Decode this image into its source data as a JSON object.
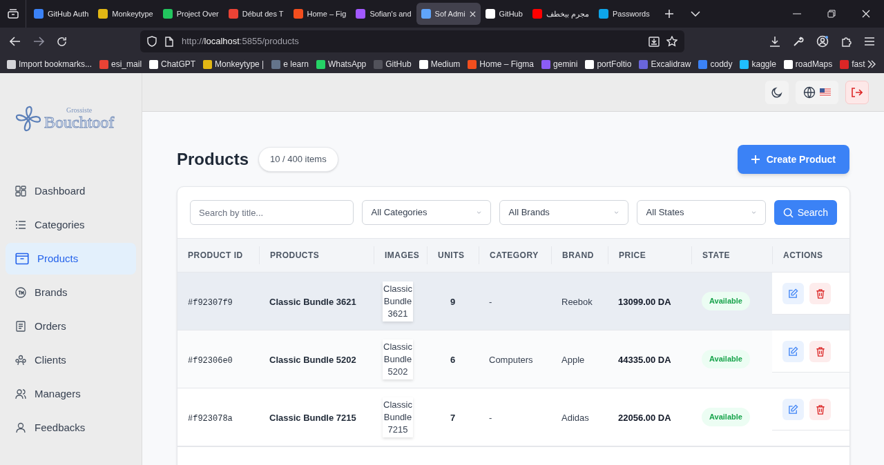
{
  "browser": {
    "tabs": [
      {
        "title": "GitHub Auth",
        "selected": false,
        "color": "#3b82f6"
      },
      {
        "title": "Monkeytype",
        "selected": false,
        "color": "#e2b714"
      },
      {
        "title": "Project Over",
        "selected": false,
        "color": "#22c55e"
      },
      {
        "title": "Début des T",
        "selected": false,
        "color": "#ea4335"
      },
      {
        "title": "Home – Fig",
        "selected": false,
        "color": "#f24e1e"
      },
      {
        "title": "Sofian's and",
        "selected": false,
        "color": "#a259ff"
      },
      {
        "title": "Sof Admi",
        "selected": true,
        "color": "#60a5fa"
      },
      {
        "title": "GitHub",
        "selected": false,
        "color": "#ffffff"
      },
      {
        "title": "مجرم بيخطف",
        "selected": false,
        "color": "#ff0000"
      },
      {
        "title": "Passwords",
        "selected": false,
        "color": "#0ea5e9"
      }
    ],
    "url_scheme": "http://",
    "url_host": "localhost",
    "url_rest": ":5855/products",
    "bookmarks": [
      {
        "label": "Import bookmarks...",
        "color": "#d4d4d8"
      },
      {
        "label": "esi_mail",
        "color": "#ea4335"
      },
      {
        "label": "ChatGPT",
        "color": "#ffffff"
      },
      {
        "label": "Monkeytype |",
        "color": "#e2b714"
      },
      {
        "label": "e learn",
        "color": "#64748b"
      },
      {
        "label": "WhatsApp",
        "color": "#25d366"
      },
      {
        "label": "GitHub",
        "color": "#52525b"
      },
      {
        "label": "Medium",
        "color": "#ffffff"
      },
      {
        "label": "Home – Figma",
        "color": "#f24e1e"
      },
      {
        "label": "gemini",
        "color": "#8b5cf6"
      },
      {
        "label": "portFoltio",
        "color": "#ffffff"
      },
      {
        "label": "Excalidraw",
        "color": "#6965db"
      },
      {
        "label": "coddy",
        "color": "#3b82f6"
      },
      {
        "label": "kaggle",
        "color": "#20beff"
      },
      {
        "label": "roadMaps",
        "color": "#ffffff"
      },
      {
        "label": "fast",
        "color": "#dc2626"
      }
    ]
  },
  "sidebar": {
    "logo_small": "Grossiste",
    "logo": "Bouchtoof",
    "items": [
      {
        "label": "Dashboard",
        "selected": false
      },
      {
        "label": "Categories",
        "selected": false
      },
      {
        "label": "Products",
        "selected": true
      },
      {
        "label": "Brands",
        "selected": false
      },
      {
        "label": "Orders",
        "selected": false
      },
      {
        "label": "Clients",
        "selected": false
      },
      {
        "label": "Managers",
        "selected": false
      },
      {
        "label": "Feedbacks",
        "selected": false
      }
    ]
  },
  "page": {
    "title": "Products",
    "count": "10 / 400 items",
    "create_button": "Create Product"
  },
  "filters": {
    "search_placeholder": "Search by title...",
    "category": "All Categories",
    "brand": "All Brands",
    "state": "All States",
    "search_button": "Search"
  },
  "table": {
    "columns": [
      "PRODUCT ID",
      "PRODUCTS",
      "IMAGES",
      "UNITS",
      "CATEGORY",
      "BRAND",
      "PRICE",
      "STATE",
      "ACTIONS"
    ],
    "rows": [
      {
        "id": "#f92307f9",
        "product": "Classic Bundle 3621",
        "image_alt": "Classic Bundle 3621",
        "units": "9",
        "category": "-",
        "brand": "Reebok",
        "price": "13099.00 DA",
        "state": "Available",
        "selected": true
      },
      {
        "id": "#f92306e0",
        "product": "Classic Bundle 5202",
        "image_alt": "Classic Bundle 5202",
        "units": "6",
        "category": "Computers",
        "brand": "Apple",
        "price": "44335.00 DA",
        "state": "Available",
        "selected": false
      },
      {
        "id": "#f923078a",
        "product": "Classic Bundle 7215",
        "image_alt": "Classic Bundle 7215",
        "units": "7",
        "category": "-",
        "brand": "Adidas",
        "price": "22056.00 DA",
        "state": "Available",
        "selected": false
      }
    ]
  }
}
